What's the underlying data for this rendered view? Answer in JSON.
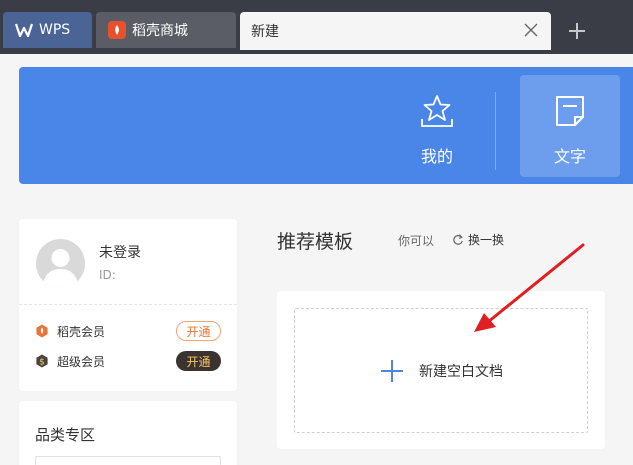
{
  "tabs": {
    "wps": "WPS",
    "daoke": "稻壳商城",
    "new": "新建"
  },
  "banner": {
    "mine_label": "我的",
    "doc_label": "文字"
  },
  "user": {
    "name": "未登录",
    "id_label": "ID:"
  },
  "members": [
    {
      "label": "稻壳会员",
      "button": "开通"
    },
    {
      "label": "超级会员",
      "button": "开通"
    }
  ],
  "category": {
    "title": "品类专区"
  },
  "main": {
    "section_title": "推荐模板",
    "hint": "你可以",
    "refresh_label": "换一换",
    "blank_doc_label": "新建空白文档"
  },
  "colors": {
    "tabbar": "#3a3d45",
    "banner": "#4a86e8",
    "accent": "#4a86e8",
    "annotation_arrow": "#e02020"
  }
}
